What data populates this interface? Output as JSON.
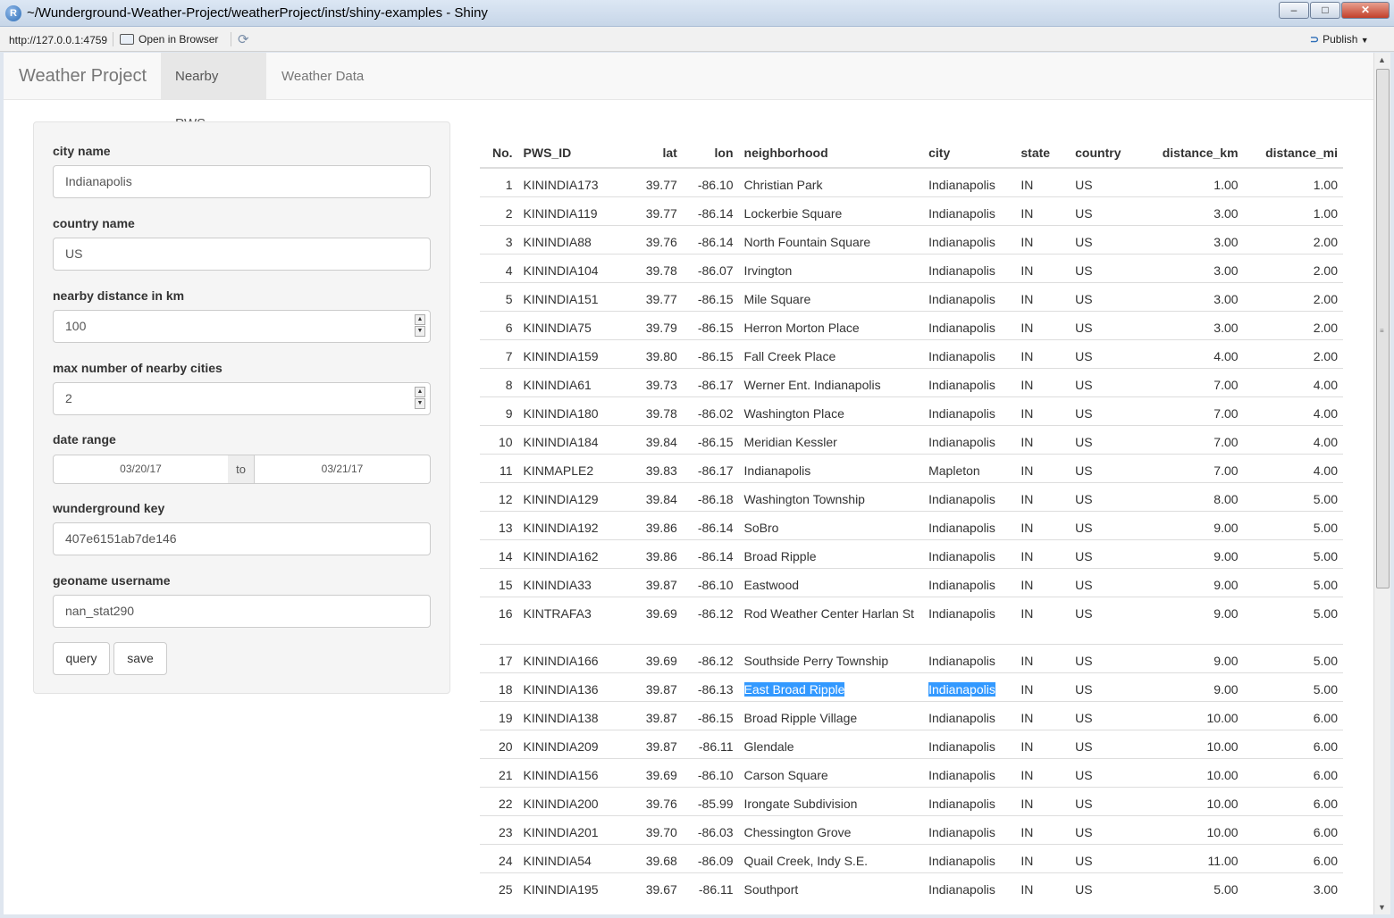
{
  "window": {
    "title": "~/Wunderground-Weather-Project/weatherProject/inst/shiny-examples - Shiny",
    "controls": {
      "minimize": "–",
      "maximize": "□",
      "close": "✕"
    }
  },
  "toolbar": {
    "url": "http://127.0.0.1:4759",
    "open_in_browser": "Open in Browser",
    "publish": "Publish"
  },
  "navbar": {
    "brand": "Weather Project",
    "tabs": [
      {
        "label": "Nearby PWS",
        "active": true
      },
      {
        "label": "Weather Data",
        "active": false
      }
    ]
  },
  "sidebar": {
    "city_label": "city name",
    "city_value": "Indianapolis",
    "country_label": "country name",
    "country_value": "US",
    "distance_label": "nearby distance in km",
    "distance_value": "100",
    "max_cities_label": "max number of nearby cities",
    "max_cities_value": "2",
    "date_range_label": "date range",
    "date_start": "03/20/17",
    "date_to": "to",
    "date_end": "03/21/17",
    "wunderground_label": "wunderground key",
    "wunderground_value": "407e6151ab7de146",
    "geoname_label": "geoname username",
    "geoname_value": "nan_stat290",
    "query_button": "query",
    "save_button": "save"
  },
  "table": {
    "columns": [
      "No.",
      "PWS_ID",
      "lat",
      "lon",
      "neighborhood",
      "city",
      "state",
      "country",
      "distance_km",
      "distance_mi"
    ],
    "rows": [
      [
        "1",
        "KININDIA173",
        "39.77",
        "-86.10",
        "Christian Park",
        "Indianapolis",
        "IN",
        "US",
        "1.00",
        "1.00"
      ],
      [
        "2",
        "KININDIA119",
        "39.77",
        "-86.14",
        "Lockerbie Square",
        "Indianapolis",
        "IN",
        "US",
        "3.00",
        "1.00"
      ],
      [
        "3",
        "KININDIA88",
        "39.76",
        "-86.14",
        "North Fountain Square",
        "Indianapolis",
        "IN",
        "US",
        "3.00",
        "2.00"
      ],
      [
        "4",
        "KININDIA104",
        "39.78",
        "-86.07",
        "Irvington",
        "Indianapolis",
        "IN",
        "US",
        "3.00",
        "2.00"
      ],
      [
        "5",
        "KININDIA151",
        "39.77",
        "-86.15",
        "Mile Square",
        "Indianapolis",
        "IN",
        "US",
        "3.00",
        "2.00"
      ],
      [
        "6",
        "KININDIA75",
        "39.79",
        "-86.15",
        "Herron Morton Place",
        "Indianapolis",
        "IN",
        "US",
        "3.00",
        "2.00"
      ],
      [
        "7",
        "KININDIA159",
        "39.80",
        "-86.15",
        "Fall Creek Place",
        "Indianapolis",
        "IN",
        "US",
        "4.00",
        "2.00"
      ],
      [
        "8",
        "KININDIA61",
        "39.73",
        "-86.17",
        "Werner Ent. Indianapolis",
        "Indianapolis",
        "IN",
        "US",
        "7.00",
        "4.00"
      ],
      [
        "9",
        "KININDIA180",
        "39.78",
        "-86.02",
        "Washington Place",
        "Indianapolis",
        "IN",
        "US",
        "7.00",
        "4.00"
      ],
      [
        "10",
        "KININDIA184",
        "39.84",
        "-86.15",
        "Meridian Kessler",
        "Indianapolis",
        "IN",
        "US",
        "7.00",
        "4.00"
      ],
      [
        "11",
        "KINMAPLE2",
        "39.83",
        "-86.17",
        "Indianapolis",
        "Mapleton",
        "IN",
        "US",
        "7.00",
        "4.00"
      ],
      [
        "12",
        "KININDIA129",
        "39.84",
        "-86.18",
        "Washington Township",
        "Indianapolis",
        "IN",
        "US",
        "8.00",
        "5.00"
      ],
      [
        "13",
        "KININDIA192",
        "39.86",
        "-86.14",
        "SoBro",
        "Indianapolis",
        "IN",
        "US",
        "9.00",
        "5.00"
      ],
      [
        "14",
        "KININDIA162",
        "39.86",
        "-86.14",
        "Broad Ripple",
        "Indianapolis",
        "IN",
        "US",
        "9.00",
        "5.00"
      ],
      [
        "15",
        "KININDIA33",
        "39.87",
        "-86.10",
        "Eastwood",
        "Indianapolis",
        "IN",
        "US",
        "9.00",
        "5.00"
      ],
      [
        "16",
        "KINTRAFA3",
        "39.69",
        "-86.12",
        "Rod Weather Center Harlan St",
        "Indianapolis",
        "IN",
        "US",
        "9.00",
        "5.00"
      ],
      [
        "17",
        "KININDIA166",
        "39.69",
        "-86.12",
        "Southside Perry Township",
        "Indianapolis",
        "IN",
        "US",
        "9.00",
        "5.00"
      ],
      [
        "18",
        "KININDIA136",
        "39.87",
        "-86.13",
        "East Broad Ripple",
        "Indianapolis",
        "IN",
        "US",
        "9.00",
        "5.00"
      ],
      [
        "19",
        "KININDIA138",
        "39.87",
        "-86.15",
        "Broad Ripple Village",
        "Indianapolis",
        "IN",
        "US",
        "10.00",
        "6.00"
      ],
      [
        "20",
        "KININDIA209",
        "39.87",
        "-86.11",
        "Glendale",
        "Indianapolis",
        "IN",
        "US",
        "10.00",
        "6.00"
      ],
      [
        "21",
        "KININDIA156",
        "39.69",
        "-86.10",
        "Carson Square",
        "Indianapolis",
        "IN",
        "US",
        "10.00",
        "6.00"
      ],
      [
        "22",
        "KININDIA200",
        "39.76",
        "-85.99",
        "Irongate Subdivision",
        "Indianapolis",
        "IN",
        "US",
        "10.00",
        "6.00"
      ],
      [
        "23",
        "KININDIA201",
        "39.70",
        "-86.03",
        "Chessington Grove",
        "Indianapolis",
        "IN",
        "US",
        "10.00",
        "6.00"
      ],
      [
        "24",
        "KININDIA54",
        "39.68",
        "-86.09",
        "Quail Creek, Indy S.E.",
        "Indianapolis",
        "IN",
        "US",
        "11.00",
        "6.00"
      ],
      [
        "25",
        "KININDIA195",
        "39.67",
        "-86.11",
        "Southport",
        "Indianapolis",
        "IN",
        "US",
        "5.00",
        "3.00"
      ]
    ],
    "selected_row": 18
  }
}
